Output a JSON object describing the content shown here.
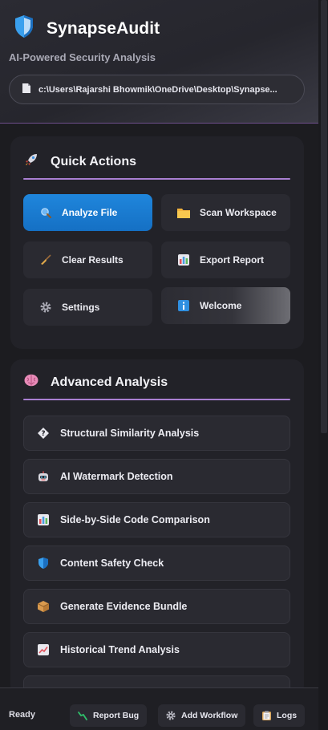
{
  "header": {
    "title": "SynapseAudit",
    "subtitle": "AI-Powered Security Analysis",
    "file_path": "c:\\Users\\Rajarshi Bhowmik\\OneDrive\\Desktop\\Synapse..."
  },
  "quick_actions": {
    "title": "Quick Actions",
    "icon": "rocket-icon",
    "buttons": [
      {
        "label": "Analyze File",
        "icon": "magnifier-icon"
      },
      {
        "label": "Scan Workspace",
        "icon": "folder-icon"
      },
      {
        "label": "Clear Results",
        "icon": "broom-icon"
      },
      {
        "label": "Export Report",
        "icon": "chart-icon"
      },
      {
        "label": "Settings",
        "icon": "gear-icon"
      },
      {
        "label": "Welcome",
        "icon": "info-icon"
      }
    ]
  },
  "advanced_analysis": {
    "title": "Advanced Analysis",
    "icon": "brain-icon",
    "items": [
      {
        "label": "Structural Similarity Analysis",
        "icon": "unknown-glyph-icon"
      },
      {
        "label": "AI Watermark Detection",
        "icon": "robot-icon"
      },
      {
        "label": "Side-by-Side Code Comparison",
        "icon": "chart-icon"
      },
      {
        "label": "Content Safety Check",
        "icon": "shield-icon"
      },
      {
        "label": "Generate Evidence Bundle",
        "icon": "package-icon"
      },
      {
        "label": "Historical Trend Analysis",
        "icon": "trend-icon"
      }
    ]
  },
  "footer": {
    "status": "Ready",
    "report_bug": "Report Bug",
    "add_workflow": "Add Workflow",
    "logs": "Logs"
  },
  "colors": {
    "accent_primary": "#1a7bd1",
    "divider": "#a97fd2",
    "background": "#1c1c20",
    "card": "#222228"
  }
}
